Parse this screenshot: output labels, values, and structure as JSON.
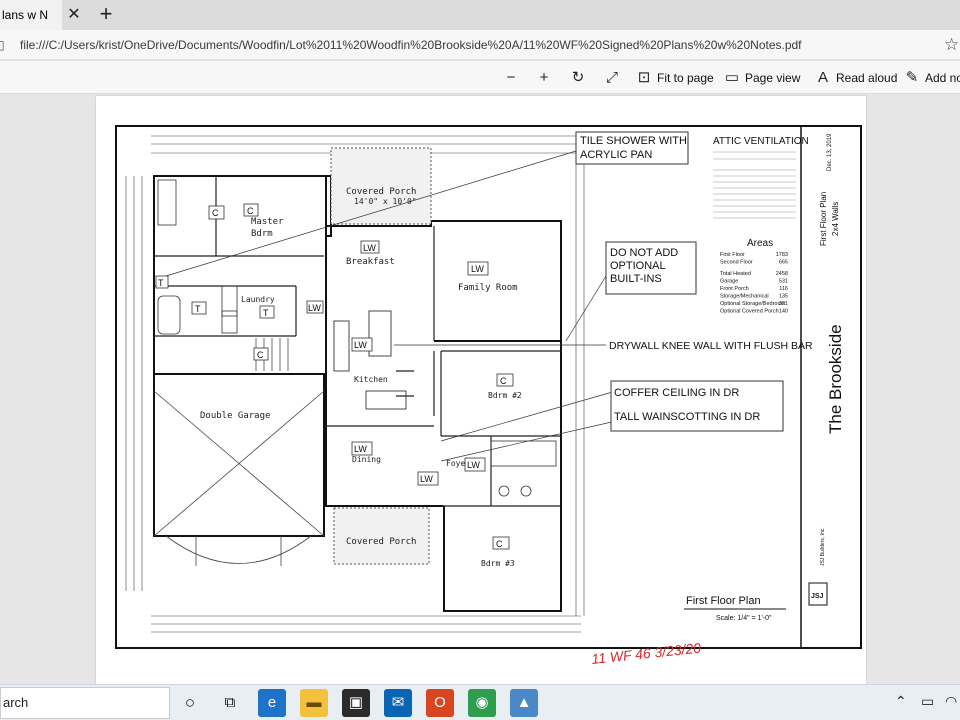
{
  "browser": {
    "tab_title": "lans w N",
    "tab_close": "✕",
    "new_tab": "+",
    "url": "file:///C:/Users/krist/OneDrive/Documents/Woodfin/Lot%2011%20Woodfin%20Brookside%20A/11%20WF%20Signed%20Plans%20w%20Notes.pdf"
  },
  "toolbar": {
    "zoom_out": "−",
    "zoom_in": "+",
    "fit_to_page": "Fit to page",
    "page_view": "Page view",
    "read_aloud": "Read aloud",
    "add_notes": "Add not"
  },
  "plan": {
    "notes": {
      "tile_shower": "TILE SHOWER WITH",
      "acrylic_pan": "ACRYLIC PAN",
      "attic_title": "ATTIC VENTILATION",
      "do_not_add": "DO NOT ADD",
      "optional": "OPTIONAL",
      "built_ins": "BUILT-INS",
      "drywall": "DRYWALL KNEE WALL WITH FLUSH BAR",
      "coffer": "COFFER CEILING IN DR",
      "wainscot": "TALL WAINSCOTTING IN DR"
    },
    "rooms": {
      "covered_porch_top": "Covered Porch",
      "porch_size": "14'0\" x 10'0\"",
      "master": "Master",
      "bdrm": "Bdrm",
      "breakfast": "Breakfast",
      "family_room": "Family Room",
      "laundry": "Laundry",
      "kitchen": "Kitchen",
      "double_garage": "Double Garage",
      "bdrm2": "Bdrm #2",
      "dining": "Dining",
      "foyer": "Foyer",
      "covered_porch_bottom": "Covered Porch",
      "bdrm3": "Bdrm #3"
    },
    "marks": {
      "c": "C",
      "lw": "LW",
      "t": "T"
    },
    "areas": {
      "title": "Areas",
      "rows": [
        {
          "label": "First Floor",
          "value": "1783"
        },
        {
          "label": "Second Floor",
          "value": "665"
        },
        {
          "label": "Total Heated",
          "value": "2458"
        },
        {
          "label": "Garage",
          "value": "531"
        },
        {
          "label": "Front Porch",
          "value": "116"
        },
        {
          "label": "Storage/Mechanical",
          "value": "135"
        },
        {
          "label": "Optional Storage/Bedroom",
          "value": "321"
        },
        {
          "label": "Optional Covered Porch",
          "value": "140"
        }
      ]
    },
    "title_block": {
      "project": "The Brookside",
      "sheet": "First Floor Plan",
      "walls": "2x4 Walls",
      "date": "Dec. 13, 2019",
      "builder": "JSJ Builders, Inc.",
      "caption": "First Floor Plan",
      "scale": "Scale: 1/4\" = 1'-0\""
    },
    "signature": "11 WF 46 3/23/20"
  },
  "taskbar": {
    "search": "arch"
  }
}
